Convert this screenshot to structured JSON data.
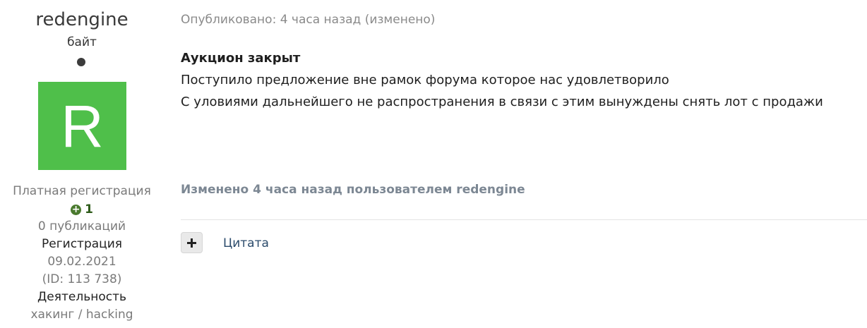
{
  "author": {
    "name": "redengine",
    "title": "байт",
    "avatar_letter": "R",
    "avatar_color": "#4fbf4a",
    "status_icon": "online-dot",
    "group": "Платная регистрация",
    "reputation": "1",
    "reputation_icon": "plus-circle-icon",
    "reputation_color": "#4a7a2e",
    "posts": "0 публикаций",
    "registration_label": "Регистрация",
    "registration_date": "09.02.2021",
    "user_id": "(ID: 113 738)",
    "activity_label": "Деятельность",
    "activity_value": "хакинг / hacking"
  },
  "post": {
    "posted_text": "Опубликовано: 4 часа назад (изменено)",
    "title": "Аукцион закрыт",
    "lines": [
      "Поступило предложение вне рамок форума которое нас удовлетворило",
      "С уловиями дальнейшего не распространения в связи с этим вынуждены снять лот с продажи"
    ],
    "edited_text": "Изменено 4 часа назад пользователем redengine"
  },
  "actions": {
    "multiquote_icon": "plus-icon",
    "quote_label": "Цитата",
    "link_color": "#2a4a6b"
  }
}
